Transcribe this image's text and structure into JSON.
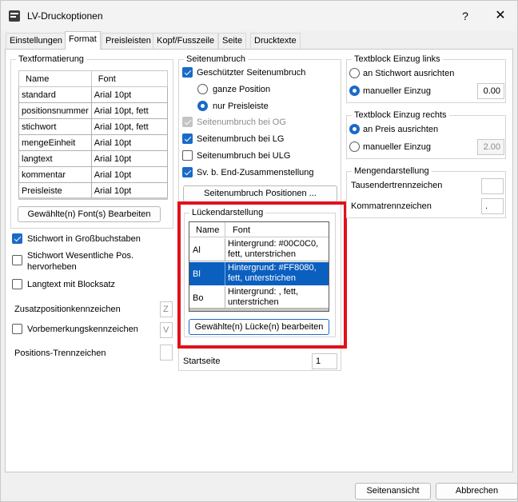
{
  "window": {
    "title": "LV-Druckoptionen",
    "help": "?",
    "close": "✕"
  },
  "tabs": [
    "Einstellungen",
    "Format",
    "Preisleisten",
    "Kopf/Fusszeile",
    "Seite",
    "Drucktexte"
  ],
  "textformatierung": {
    "legend": "Textformatierung",
    "columns": [
      "Name",
      "Font"
    ],
    "rows": [
      [
        "standard",
        "Arial 10pt"
      ],
      [
        "positionsnummer",
        "Arial 10pt, fett"
      ],
      [
        "stichwort",
        "Arial 10pt, fett"
      ],
      [
        "mengeEinheit",
        "Arial 10pt"
      ],
      [
        "langtext",
        "Arial 10pt"
      ],
      [
        "kommentar",
        "Arial 10pt"
      ],
      [
        "Preisleiste",
        "Arial 10pt"
      ]
    ],
    "button": "Gewählte(n) Font(s) Bearbeiten"
  },
  "left_options": {
    "stichwort_gross": "Stichwort in Großbuchstaben",
    "stichwort_wesentlich": "Stichwort Wesentliche Pos. hervorheben",
    "langtext_block": "Langtext mit Blocksatz",
    "zusatz_label": "Zusatzpositionkennzeichen",
    "zusatz_value": "Z",
    "vorbemerkung_label": "Vorbemerkungskennzeichen",
    "vorbemerkung_value": "V",
    "trenn_label": "Positions-Trennzeichen"
  },
  "seitenumbruch": {
    "legend": "Seitenumbruch",
    "geschuetzt": "Geschützter Seitenumbruch",
    "ganze_position": "ganze Position",
    "nur_preisleiste": "nur Preisleiste",
    "bei_og": "Seitenumbruch bei OG",
    "bei_lg": "Seitenumbruch bei LG",
    "bei_ulg": "Seitenumbruch bei ULG",
    "sv_end": "Sv. b. End-Zusammenstellung",
    "positionen_button": "Seitenumbruch Positionen ..."
  },
  "lueckendarstellung": {
    "legend": "Lückendarstellung",
    "columns": [
      "Name",
      "Font"
    ],
    "rows": [
      {
        "name": "Al",
        "font_line1": "Hintergrund: #00C0C0,",
        "font_line2": "fett, unterstrichen"
      },
      {
        "name": "Bl",
        "font_line1": "Hintergrund: #FF8080,",
        "font_line2": "fett, unterstrichen"
      },
      {
        "name": "Bo",
        "font_line1": "Hintergrund: , fett,",
        "font_line2": "unterstrichen"
      }
    ],
    "button": "Gewählte(n) Lücke(n) bearbeiten",
    "highlight_color": "#e0111b",
    "selected_color": "#0b5fbf"
  },
  "startseite": {
    "label": "Startseite",
    "value": "1"
  },
  "textblock_links": {
    "legend": "Textblock Einzug links",
    "an_stichwort": "an Stichwort ausrichten",
    "manuell": "manueller Einzug",
    "value": "0.00"
  },
  "textblock_rechts": {
    "legend": "Textblock Einzug rechts",
    "an_preis": "an Preis ausrichten",
    "manuell": "manueller Einzug",
    "value": "2.00"
  },
  "mengendarstellung": {
    "legend": "Mengendarstellung",
    "tausender": "Tausendertrennzeichen",
    "komma": "Kommatrennzeichen",
    "komma_value": "."
  },
  "footer": {
    "seitenansicht": "Seitenansicht",
    "abbrechen": "Abbrechen"
  }
}
